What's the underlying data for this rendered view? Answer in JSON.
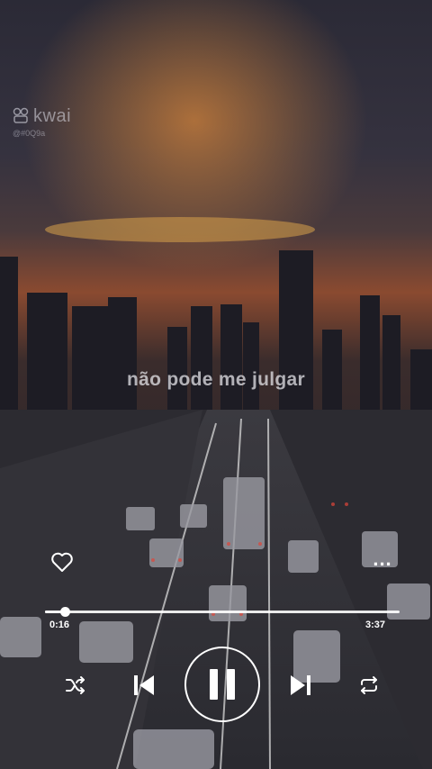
{
  "watermark": {
    "brand": "kwai",
    "handle": "@#0Q9a",
    "icon": "kwai-logo-icon"
  },
  "lyrics": {
    "current_line": "não pode me julgar"
  },
  "player": {
    "current_time": "0:16",
    "total_time": "3:37",
    "progress": 0.055,
    "state": "playing",
    "more_label": "..."
  },
  "icons": {
    "like": "heart-icon",
    "more": "more-dots-icon",
    "shuffle": "shuffle-icon",
    "previous": "skip-previous-icon",
    "pause": "pause-icon",
    "next": "skip-next-icon",
    "repeat": "repeat-icon"
  },
  "colors": {
    "controls": "#ffffff",
    "sky": "#2a2833",
    "sunset": "#c9622a"
  }
}
